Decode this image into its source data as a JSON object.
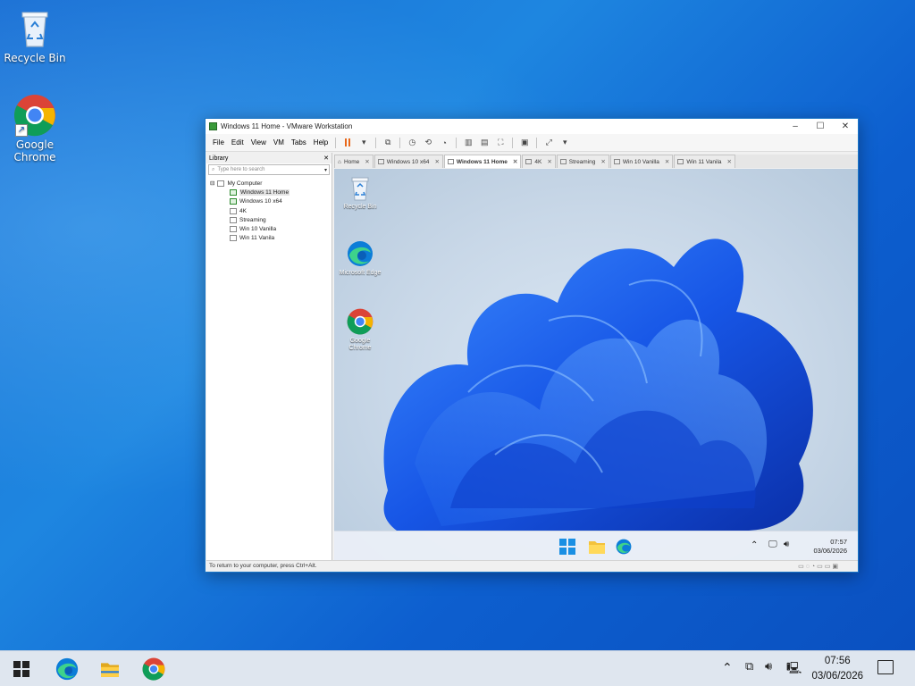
{
  "desktop": {
    "icons": [
      {
        "label": "Recycle Bin"
      },
      {
        "label": "Google Chrome"
      }
    ]
  },
  "vmware": {
    "title": "Windows 11 Home - VMware Workstation",
    "menu": [
      "File",
      "Edit",
      "View",
      "VM",
      "Tabs",
      "Help"
    ],
    "library": {
      "header": "Library",
      "search_placeholder": "Type here to search",
      "root": "My Computer",
      "items": [
        "Windows 11 Home",
        "Windows 10 x64",
        "4K",
        "Streaming",
        "Win 10 Vanilla",
        "Win 11 Vanila"
      ],
      "selected_item": "Windows 11 Home"
    },
    "tabs": [
      "Home",
      "Windows 10 x64",
      "Windows 11 Home",
      "4K",
      "Streaming",
      "Win 10 Vanilla",
      "Win 11 Vanila"
    ],
    "active_tab": "Windows 11 Home",
    "guest": {
      "icons": [
        "Recycle Bin",
        "Microsoft Edge",
        "Google Chrome"
      ],
      "time": "07:57",
      "date": "03/06/2026"
    },
    "status_text": "To return to your computer, press Ctrl+Alt."
  },
  "taskbar": {
    "time": "07:56",
    "date": "03/06/2026"
  },
  "colors": {
    "desktop_blue": "#1a78d8",
    "accent": "#0078d4",
    "pause_orange": "#e8681a"
  }
}
